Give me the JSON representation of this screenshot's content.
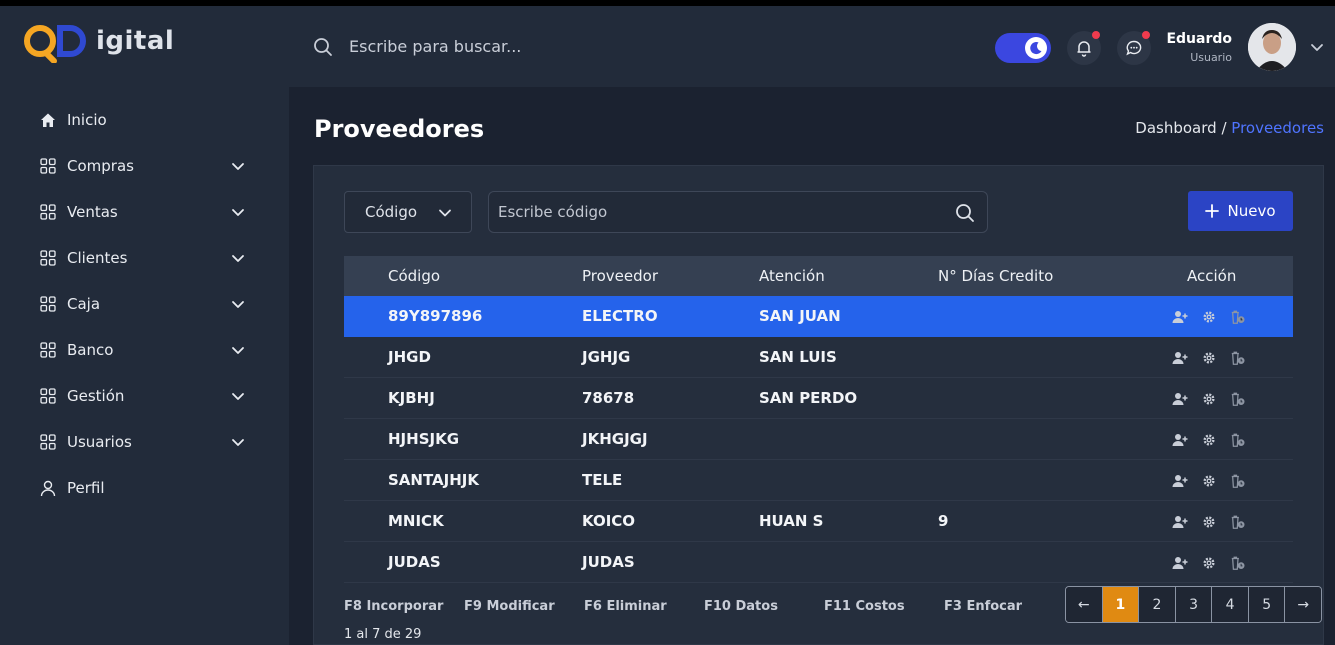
{
  "header": {
    "logo_text": "igital",
    "search_placeholder": "Escribe para buscar...",
    "user_name": "Eduardo",
    "user_role": "Usuario"
  },
  "sidebar": {
    "items": [
      {
        "label": "Inicio",
        "icon": "home-icon",
        "has_caret": false
      },
      {
        "label": "Compras",
        "icon": "grid-icon",
        "has_caret": true
      },
      {
        "label": "Ventas",
        "icon": "grid-icon",
        "has_caret": true
      },
      {
        "label": "Clientes",
        "icon": "grid-icon",
        "has_caret": true
      },
      {
        "label": "Caja",
        "icon": "grid-icon",
        "has_caret": true
      },
      {
        "label": "Banco",
        "icon": "grid-icon",
        "has_caret": true
      },
      {
        "label": "Gestión",
        "icon": "grid-icon",
        "has_caret": true
      },
      {
        "label": "Usuarios",
        "icon": "grid-icon",
        "has_caret": true
      },
      {
        "label": "Perfil",
        "icon": "user-icon",
        "has_caret": false
      }
    ]
  },
  "main": {
    "title": "Proveedores",
    "breadcrumb_parent": "Dashboard /",
    "breadcrumb_current": "Proveedores",
    "filter_select_value": "Código",
    "filter_placeholder": "Escribe código",
    "new_button_label": "Nuevo",
    "columns": [
      "Código",
      "Proveedor",
      "Atención",
      "N° Días Credito",
      "Acción"
    ],
    "rows": [
      {
        "codigo": "89Y897896",
        "proveedor": "ELECTRO",
        "atencion": "SAN JUAN",
        "dias": "",
        "selected": true
      },
      {
        "codigo": "JHGD",
        "proveedor": "JGHJG",
        "atencion": "SAN LUIS",
        "dias": "",
        "selected": false
      },
      {
        "codigo": "KJBHJ",
        "proveedor": "78678",
        "atencion": "SAN PERDO",
        "dias": "",
        "selected": false
      },
      {
        "codigo": "HJHSJKG",
        "proveedor": "JKHGJGJ",
        "atencion": "",
        "dias": "",
        "selected": false
      },
      {
        "codigo": "SANTAJHJK",
        "proveedor": "TELE",
        "atencion": "",
        "dias": "",
        "selected": false
      },
      {
        "codigo": "MNICK",
        "proveedor": "KOICO",
        "atencion": "HUAN S",
        "dias": "9",
        "selected": false
      },
      {
        "codigo": "JUDAS",
        "proveedor": "JUDAS",
        "atencion": "",
        "dias": "",
        "selected": false
      }
    ],
    "function_keys": [
      "F8 Incorporar",
      "F9 Modificar",
      "F6 Eliminar",
      "F10 Datos",
      "F11 Costos",
      "F3 Enfocar"
    ],
    "page_info": "1 al 7 de 29",
    "pagination": {
      "pages": [
        "1",
        "2",
        "3",
        "4",
        "5"
      ],
      "current": "1",
      "prev": "←",
      "next": "→"
    }
  },
  "colors": {
    "accent": "#2563eb",
    "new_button": "#2b44c5",
    "active_page": "#e08a12",
    "notification_dot": "#ef3b4e"
  }
}
